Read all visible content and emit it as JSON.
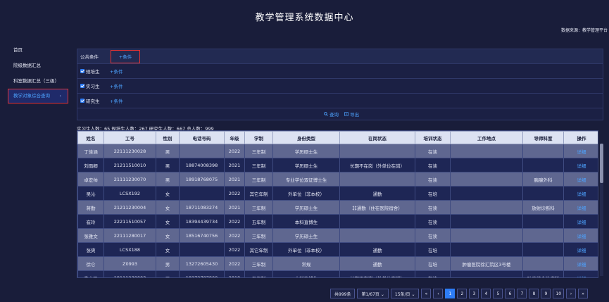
{
  "header": {
    "title": "教学管理系统数据中心",
    "source": "数据来源：教学管理平台"
  },
  "sidebar": {
    "items": [
      {
        "label": "首页"
      },
      {
        "label": "院级数据汇总"
      },
      {
        "label": "科室数据汇总（三级）"
      },
      {
        "label": "教学对象综合查询",
        "chevron": "›"
      }
    ]
  },
  "filters": {
    "rows": [
      {
        "label": "公共条件",
        "add": "+条件"
      },
      {
        "label": "规培生",
        "add": "+条件"
      },
      {
        "label": "实习生",
        "add": "+条件"
      },
      {
        "label": "研究生",
        "add": "+条件"
      }
    ],
    "query_label": "查询",
    "export_label": "导出"
  },
  "summary": "实习生人数：65 规培生人数：267 研究生人数：667 总人数：999",
  "table": {
    "headers": [
      "姓名",
      "工号",
      "性别",
      "电话号码",
      "年级",
      "学制",
      "身份类型",
      "在岗状态",
      "培训状态",
      "工作地点",
      "导师科室",
      "操作"
    ],
    "rows": [
      [
        "丁佳涵",
        "22111230028",
        "男",
        "",
        "2022",
        "三年制",
        "学历硕士生",
        "",
        "在读",
        "",
        "",
        "详细"
      ],
      [
        "刘雨卿",
        "21211510010",
        "男",
        "18874008398",
        "2021",
        "三年制",
        "学历硕士生",
        "长期不在岗（外单位在岗）",
        "在读",
        "",
        "",
        "详细"
      ],
      [
        "卓宏帅",
        "21111230070",
        "男",
        "18918768075",
        "2021",
        "三年制",
        "专业学位双证博士生",
        "",
        "在读",
        "",
        "胰腺外科",
        "详细"
      ],
      [
        "吴沁",
        "LCSX192",
        "女",
        "",
        "2022",
        "其它年制",
        "外单位（非本校）",
        "通勤",
        "在培",
        "",
        "",
        "详细"
      ],
      [
        "蒋勤",
        "21211230004",
        "女",
        "18711083274",
        "2021",
        "三年制",
        "学历硕士生",
        "非通勤（住在医院宿舍）",
        "在读",
        "",
        "放射诊断科",
        "详细"
      ],
      [
        "崔玲",
        "22211510057",
        "女",
        "18394439734",
        "2022",
        "五年制",
        "本科直博生",
        "",
        "在读",
        "",
        "",
        "详细"
      ],
      [
        "张雅文",
        "22111280017",
        "女",
        "18516740756",
        "2022",
        "三年制",
        "学历硕士生",
        "",
        "在读",
        "",
        "",
        "详细"
      ],
      [
        "张爽",
        "LCSX188",
        "女",
        "",
        "2022",
        "其它年制",
        "外单位（非本校）",
        "通勤",
        "在培",
        "",
        "",
        "详细"
      ],
      [
        "徐仑",
        "Z0993",
        "男",
        "13272605430",
        "2022",
        "三年制",
        "常规",
        "通勤",
        "在培",
        "肿瘤医院徐汇院区3号楼",
        "",
        "详细"
      ],
      [
        "朱文强",
        "19111230003",
        "男",
        "18272787800",
        "2019",
        "五年制",
        "本科直博生",
        "长期不在岗（外单位在岗）",
        "在读",
        "",
        "肿瘤综合治疗科",
        "详细"
      ]
    ]
  },
  "pager": {
    "total": "共999条",
    "page_of": "第1/67页 ⌄",
    "per_page": "15条/页 ⌄",
    "first": "«",
    "prev": "‹",
    "pages": [
      "1",
      "2",
      "3",
      "4",
      "5",
      "6",
      "7",
      "8",
      "9",
      "10"
    ],
    "current": "1",
    "next": "›",
    "last": "»"
  }
}
